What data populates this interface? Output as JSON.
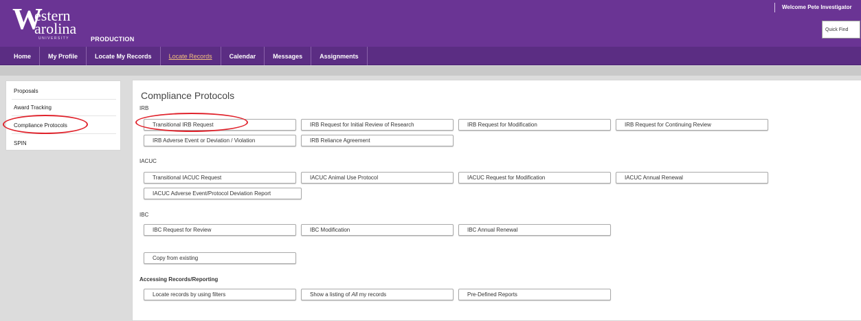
{
  "header": {
    "logo": {
      "line1": "Western",
      "line2": "Carolina",
      "line3": "UNIVERSITY"
    },
    "environment": "PRODUCTION",
    "welcome": "Welcome Pete Investigator",
    "brand_color": "#6a3494"
  },
  "nav": {
    "items": [
      {
        "label": "Home"
      },
      {
        "label": "My Profile"
      },
      {
        "label": "Locate My Records"
      },
      {
        "label": "Locate Records",
        "active": true
      },
      {
        "label": "Calendar"
      },
      {
        "label": "Messages"
      },
      {
        "label": "Assignments"
      }
    ],
    "quick_find": "Quick Find"
  },
  "sidebar": {
    "items": [
      {
        "label": "Proposals"
      },
      {
        "label": "Award Tracking"
      },
      {
        "label": "Compliance Protocols",
        "highlighted": true
      },
      {
        "label": "SPIN"
      }
    ]
  },
  "main": {
    "title": "Compliance Protocols",
    "irb": {
      "heading": "IRB",
      "buttons": [
        "Transitional IRB Request",
        "IRB Request for Initial Review of Research",
        "IRB Request for Modification",
        "IRB Request for Continuing Review",
        "IRB Adverse Event or Deviation / Violation",
        "IRB Reliance Agreement"
      ]
    },
    "iacuc": {
      "heading": "IACUC",
      "buttons": [
        "Transitional IACUC Request",
        "IACUC Animal Use Protocol",
        "IACUC Request for Modification",
        "IACUC Annual Renewal",
        "IACUC Adverse Event/Protocol Deviation Report"
      ]
    },
    "ibc": {
      "heading": "IBC",
      "buttons": [
        "IBC Request for Review",
        "IBC Modification",
        "IBC Annual Renewal"
      ]
    },
    "copy_button": "Copy from existing",
    "reporting": {
      "heading": "Accessing Records/Reporting",
      "buttons": [
        "Locate records by using filters",
        {
          "prefix": "Show a listing of ",
          "emphasis": "All",
          "suffix": " my records"
        },
        "Pre-Defined Reports"
      ]
    }
  },
  "annotation_color": "#e0232c"
}
